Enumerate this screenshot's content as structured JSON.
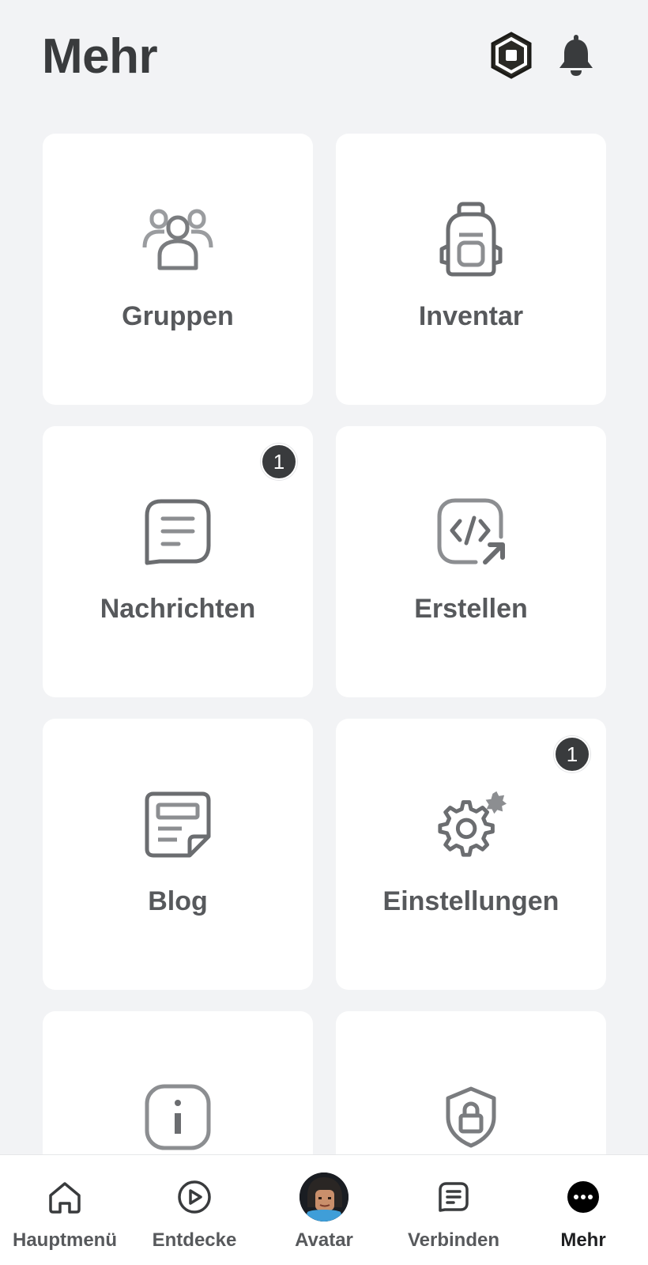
{
  "header": {
    "title": "Mehr",
    "robux_icon": "robux-icon",
    "notifications_icon": "bell-icon"
  },
  "tiles": [
    {
      "label": "Gruppen",
      "icon": "groups-icon",
      "badge": null
    },
    {
      "label": "Inventar",
      "icon": "backpack-icon",
      "badge": null
    },
    {
      "label": "Nachrichten",
      "icon": "message-icon",
      "badge": "1"
    },
    {
      "label": "Erstellen",
      "icon": "code-create-icon",
      "badge": null
    },
    {
      "label": "Blog",
      "icon": "blog-icon",
      "badge": null
    },
    {
      "label": "Einstellungen",
      "icon": "settings-gear-icon",
      "badge": "1"
    },
    {
      "label": "",
      "icon": "info-icon",
      "badge": null
    },
    {
      "label": "",
      "icon": "shield-lock-icon",
      "badge": null
    }
  ],
  "bottom_nav": [
    {
      "label": "Hauptmenü",
      "icon": "home-icon",
      "active": false
    },
    {
      "label": "Entdecke",
      "icon": "play-circle-icon",
      "active": false
    },
    {
      "label": "Avatar",
      "icon": "avatar-image",
      "active": false
    },
    {
      "label": "Verbinden",
      "icon": "chat-icon",
      "active": false
    },
    {
      "label": "Mehr",
      "icon": "more-dots-icon",
      "active": true
    }
  ],
  "colors": {
    "background": "#f2f3f5",
    "tile": "#ffffff",
    "text": "#393b3d",
    "icon": "#6b6d70",
    "badge": "#393b3d"
  }
}
